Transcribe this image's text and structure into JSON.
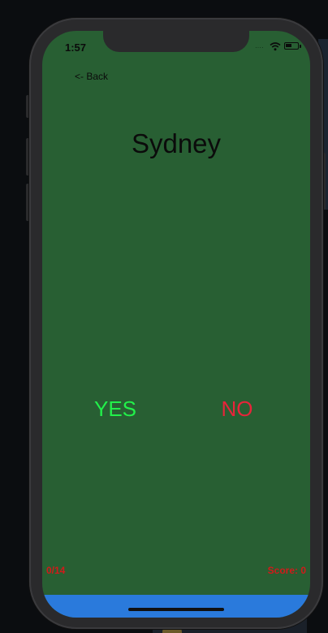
{
  "status_bar": {
    "time": "1:57"
  },
  "nav": {
    "back_label": "<- Back"
  },
  "quiz": {
    "city": "Sydney",
    "yes_label": "YES",
    "no_label": "NO",
    "progress": "0/14",
    "score": "Score: 0"
  },
  "colors": {
    "background": "#285f33",
    "yes": "#22f04a",
    "no": "#e8243a",
    "counters": "#d11a1a",
    "bottom_bar": "#2a7adc"
  },
  "icons": {
    "wifi": "wifi-icon",
    "battery": "battery-icon",
    "signal": "signal-dots-icon"
  }
}
